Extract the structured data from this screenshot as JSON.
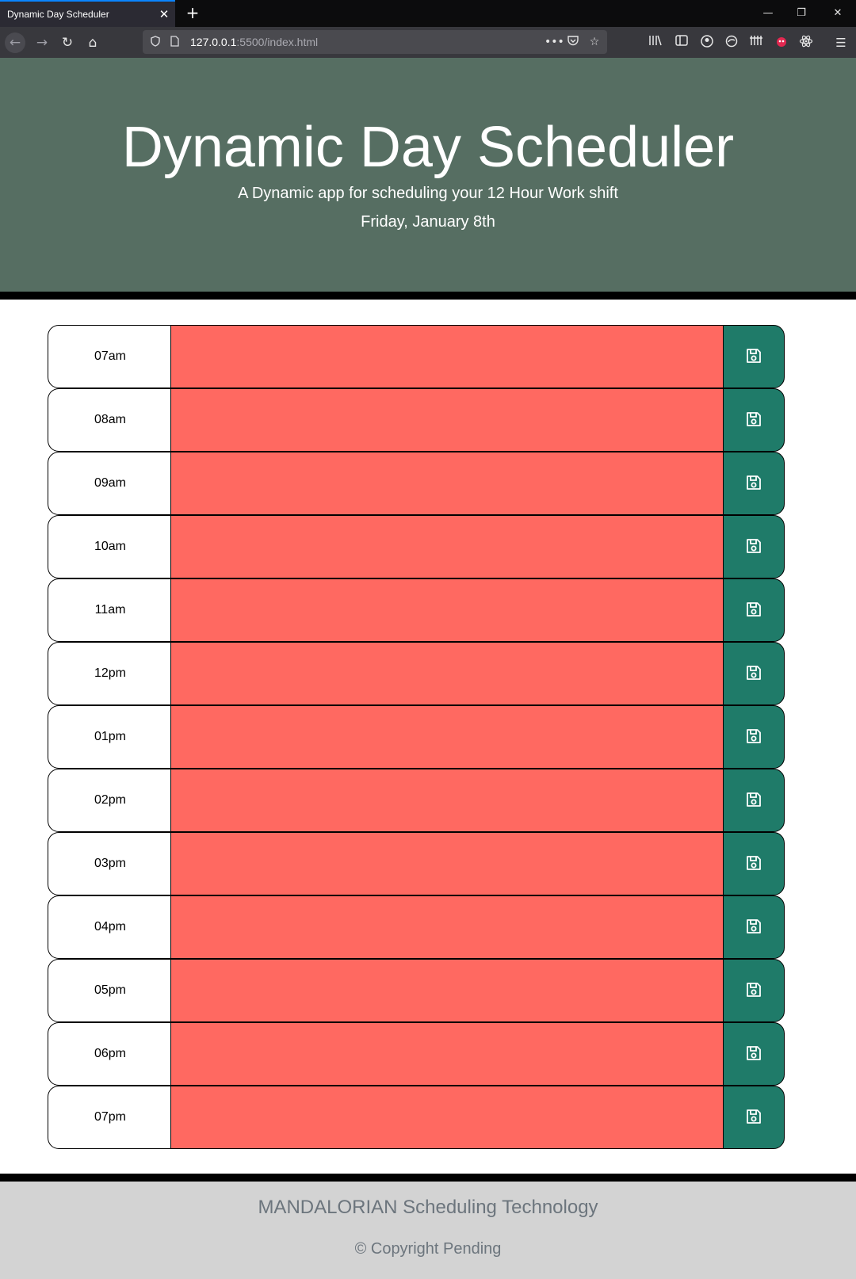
{
  "browser": {
    "tab_title": "Dynamic Day Scheduler",
    "tab_close_glyph": "✕",
    "new_tab_glyph": "+",
    "url_host": "127.0.0.1",
    "url_rest": ":5500/index.html",
    "window_controls": {
      "minimize": "—",
      "restore": "❐",
      "close": "✕"
    },
    "nav": {
      "back": "←",
      "forward": "→",
      "reload": "↻",
      "home": "⌂"
    }
  },
  "header": {
    "title": "Dynamic Day Scheduler",
    "lead": "A Dynamic app for scheduling your 12 Hour Work shift",
    "current_day": "Friday, January 8th"
  },
  "schedule": {
    "hours": [
      {
        "label": "07am",
        "text": ""
      },
      {
        "label": "08am",
        "text": ""
      },
      {
        "label": "09am",
        "text": ""
      },
      {
        "label": "10am",
        "text": ""
      },
      {
        "label": "11am",
        "text": ""
      },
      {
        "label": "12pm",
        "text": ""
      },
      {
        "label": "01pm",
        "text": ""
      },
      {
        "label": "02pm",
        "text": ""
      },
      {
        "label": "03pm",
        "text": ""
      },
      {
        "label": "04pm",
        "text": ""
      },
      {
        "label": "05pm",
        "text": ""
      },
      {
        "label": "06pm",
        "text": ""
      },
      {
        "label": "07pm",
        "text": ""
      }
    ],
    "save_icon": "save-icon"
  },
  "footer": {
    "brand": "MANDALORIAN Scheduling Technology",
    "copyright": "© Copyright Pending"
  },
  "colors": {
    "jumbotron": "#566e62",
    "past_block": "#ff6961",
    "save_button": "#1f7b69",
    "footer": "#d3d3d3",
    "footer_text": "#6c757d"
  }
}
